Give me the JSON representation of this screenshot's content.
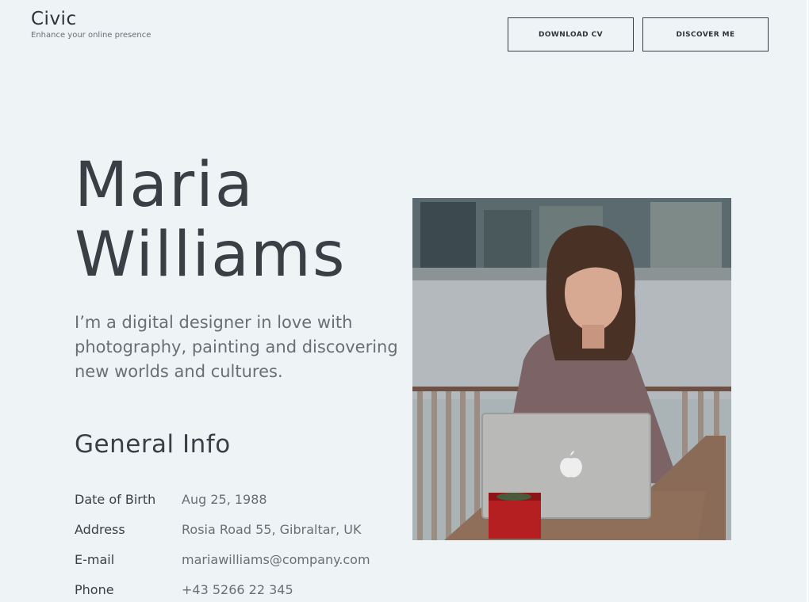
{
  "header": {
    "brand_name": "Civic",
    "brand_tagline": "Enhance your online presence",
    "download_cv_label": "DOWNLOAD CV",
    "discover_me_label": "DISCOVER ME"
  },
  "hero": {
    "first_name": "Maria",
    "last_name": "Williams",
    "bio": "I’m a digital designer in love with photography, painting and discovering new worlds and cultures."
  },
  "general_info": {
    "title": "General Info",
    "rows": [
      {
        "label": "Date of Birth",
        "value": "Aug 25, 1988"
      },
      {
        "label": "Address",
        "value": "Rosia Road 55, Gibraltar, UK"
      },
      {
        "label": "E-mail",
        "value": "mariawilliams@company.com"
      },
      {
        "label": "Phone",
        "value": "+43 5266 22 345"
      }
    ]
  },
  "colors": {
    "background": "#eef3f6",
    "heading": "#3b3e45",
    "muted_text": "#6b6e73"
  }
}
